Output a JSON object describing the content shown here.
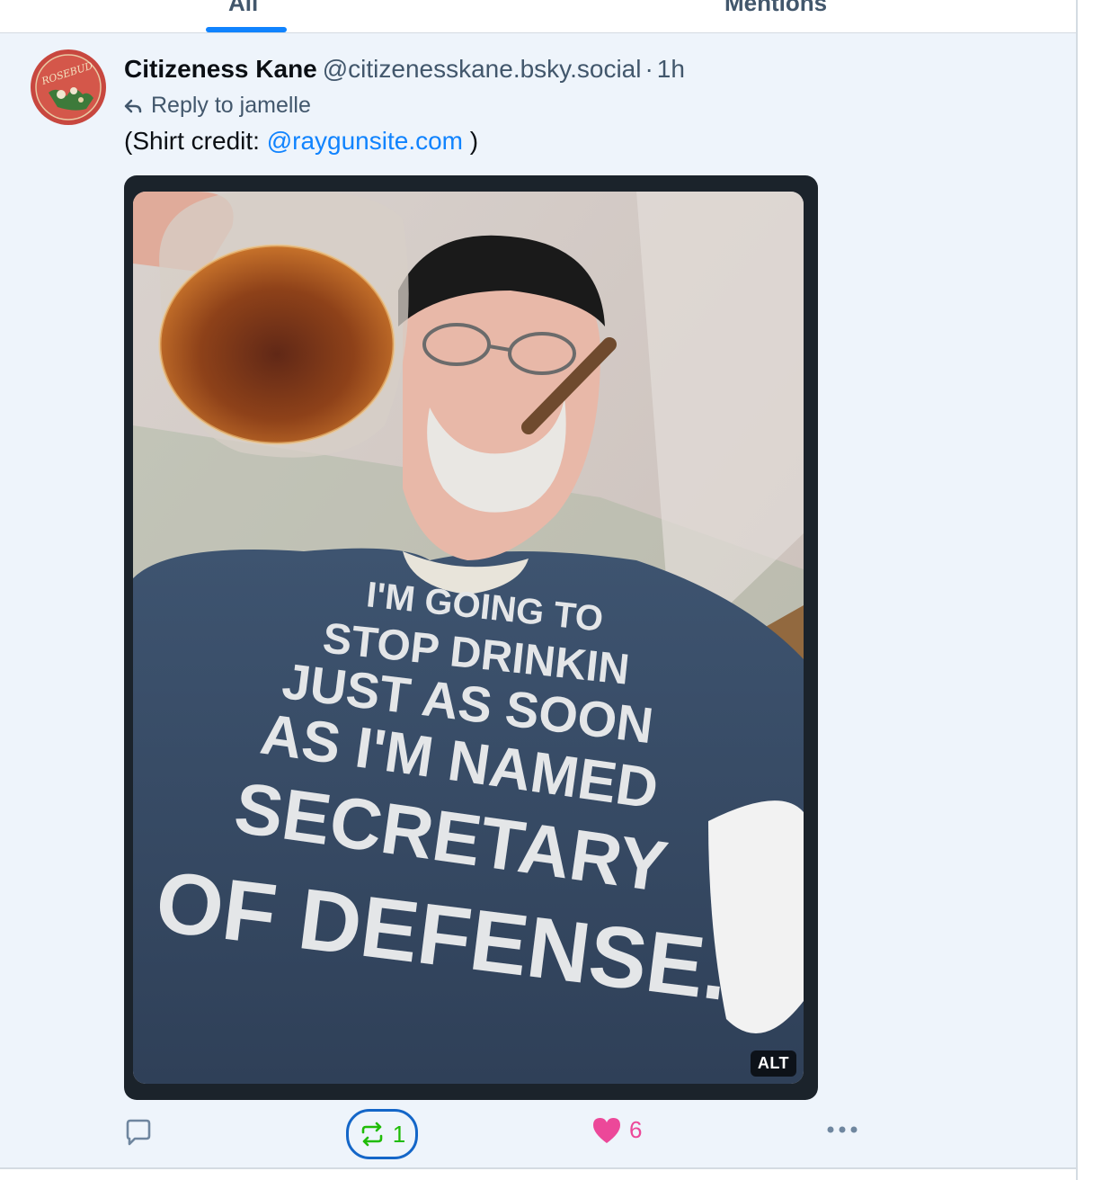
{
  "tabs": {
    "all": "All",
    "mentions": "Mentions"
  },
  "post": {
    "author_name": "Citizeness Kane",
    "author_handle": "@citizenesskane.bsky.social",
    "separator": "·",
    "timestamp": "1h",
    "reply_to": "Reply to jamelle",
    "text_prefix": "(Shirt credit: ",
    "mention": "@raygunsite.com",
    "text_suffix": " )",
    "avatar_text": "ROSEBUD",
    "image": {
      "alt_badge": "ALT",
      "shirt_lines": [
        "I'M GOING TO",
        "STOP DRINKIN",
        "JUST AS SOON",
        "AS I'M NAMED",
        "SECRETARY",
        "OF DEFENSE."
      ]
    },
    "actions": {
      "reply_icon": "speech-bubble-icon",
      "repost_icon": "repost-icon",
      "repost_count": "1",
      "like_icon": "heart-icon",
      "like_count": "6",
      "more_icon": "ellipsis-icon"
    }
  },
  "colors": {
    "accent": "#1083fe",
    "repost_active": "#20bc07",
    "like": "#ec4899",
    "post_bg": "#eef4fb",
    "muted_text": "#42576c"
  }
}
